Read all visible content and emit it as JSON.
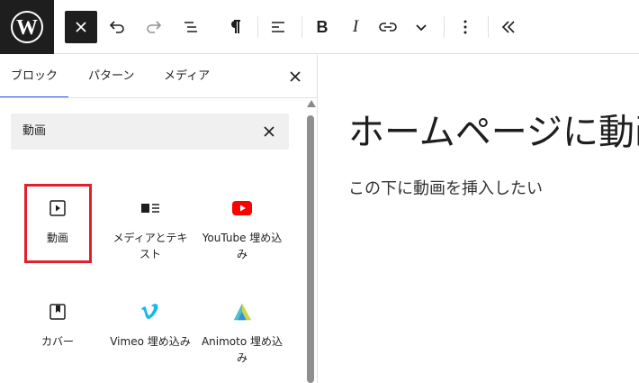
{
  "toolbar": {
    "logo": "wordpress-logo",
    "buttons": [
      "close-inserter",
      "undo",
      "redo",
      "list-view",
      "paragraph",
      "align",
      "bold",
      "italic",
      "link",
      "more-formatting",
      "options",
      "collapse"
    ],
    "bold_label": "B",
    "italic_label": "I"
  },
  "inserter": {
    "tabs": [
      {
        "label": "ブロック",
        "active": true
      },
      {
        "label": "パターン",
        "active": false
      },
      {
        "label": "メディア",
        "active": false
      }
    ],
    "search": {
      "value": "動画"
    },
    "blocks": [
      {
        "label": "動画",
        "icon": "video-icon",
        "highlighted": true
      },
      {
        "label": "メディアとテキスト",
        "icon": "media-text-icon"
      },
      {
        "label": "YouTube 埋め込み",
        "icon": "youtube-icon"
      },
      {
        "label": "カバー",
        "icon": "cover-icon"
      },
      {
        "label": "Vimeo 埋め込み",
        "icon": "vimeo-icon"
      },
      {
        "label": "Animoto 埋め込み",
        "icon": "animoto-icon"
      }
    ]
  },
  "editor": {
    "title": "ホームページに動画",
    "paragraph": "この下に動画を挿入したい"
  },
  "colors": {
    "dark": "#1e1e1e",
    "accent": "#3858e9",
    "highlight": "#e0202e",
    "youtube": "#ff0000",
    "vimeo": "#1ab7ea"
  }
}
